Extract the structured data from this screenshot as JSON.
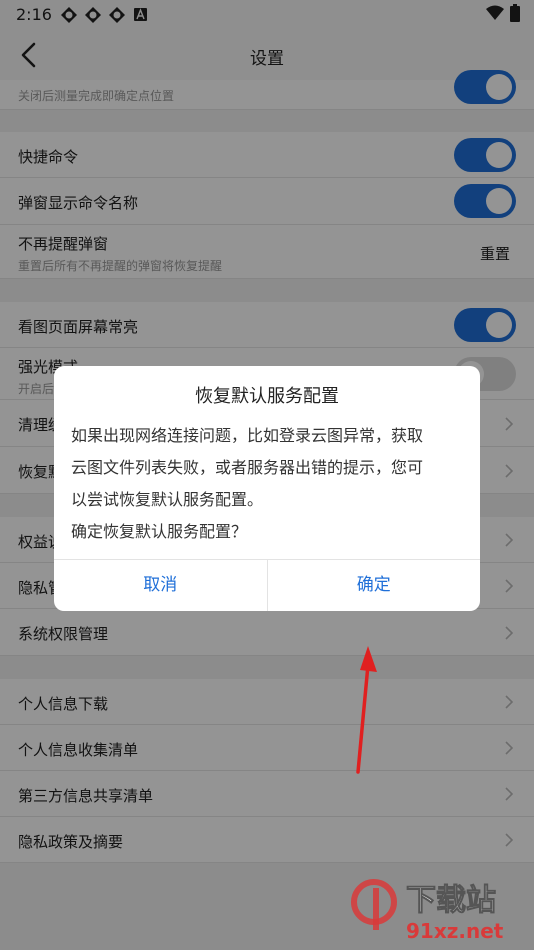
{
  "status_bar": {
    "time": "2:16"
  },
  "header": {
    "title": "设置"
  },
  "rows": {
    "partial_sub": "关闭后测量完成即确定点位置",
    "quick_command": "快捷命令",
    "popup_command_name": "弹窗显示命令名称",
    "no_remind": {
      "label": "不再提醒弹窗",
      "sub": "重置后所有不再提醒的弹窗将恢复提醒",
      "action": "重置"
    },
    "screen_on": "看图页面屏幕常亮",
    "strong_light": {
      "label": "强光模式",
      "sub": "开启后"
    },
    "clear": "清理缓",
    "restore": "恢复默",
    "rights": "权益说",
    "privacy": "隐私管",
    "system_permission": "系统权限管理",
    "personal_download": "个人信息下载",
    "personal_collect": "个人信息收集清单",
    "third_party": "第三方信息共享清单",
    "privacy_policy": "隐私政策及摘要"
  },
  "dialog": {
    "title": "恢复默认服务配置",
    "message_line1": "如果出现网络连接问题，比如登录云图异常，获取",
    "message_line2": "云图文件列表失败，或者服务器出错的提示，您可",
    "message_line3": "以尝试恢复默认服务配置。",
    "message_line4": "确定恢复默认服务配置？",
    "cancel": "取消",
    "confirm": "确定"
  },
  "watermark": {
    "brand": "下载站",
    "site": "91xz.net"
  },
  "colors": {
    "accent": "#1f6fd8",
    "arrow": "#e02020"
  }
}
